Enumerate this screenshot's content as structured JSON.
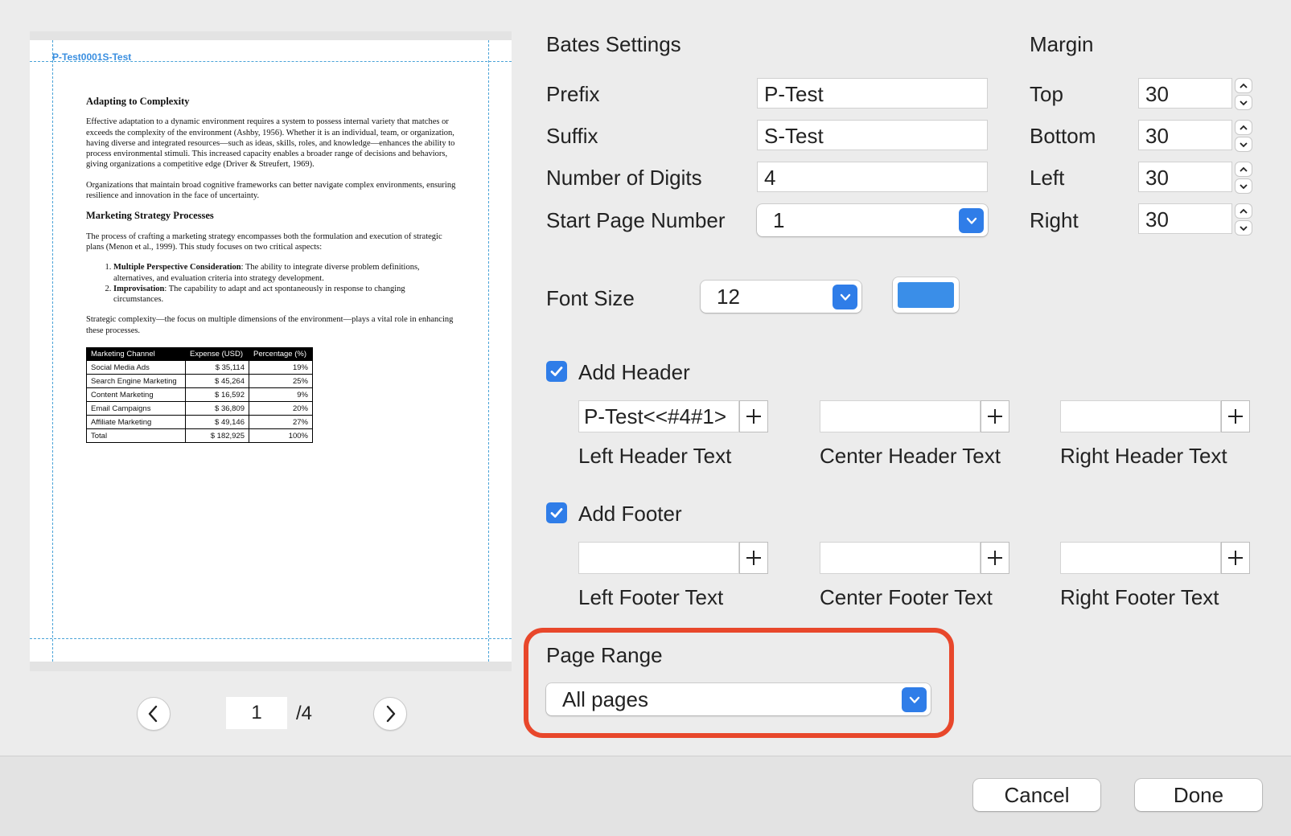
{
  "preview": {
    "bates_stamp": "P-Test0001S-Test",
    "doc": {
      "h1": "Adapting to Complexity",
      "p1": "Effective adaptation to a dynamic environment requires a system to possess internal variety that matches or exceeds the complexity of the environment (Ashby, 1956). Whether it is an individual, team, or organization, having diverse and integrated resources—such as ideas, skills, roles, and knowledge—enhances the ability to process environmental stimuli. This increased capacity enables a broader range of decisions and behaviors, giving organizations a competitive edge (Driver & Streufert, 1969).",
      "p2": "Organizations that maintain broad cognitive frameworks can better navigate complex environments, ensuring resilience and innovation in the face of uncertainty.",
      "h2": "Marketing Strategy Processes",
      "p3": "The process of crafting a marketing strategy encompasses both the formulation and execution of strategic plans (Menon et al., 1999). This study focuses on two critical aspects:",
      "li1_bold": "Multiple Perspective Consideration",
      "li1_text": ": The ability to integrate diverse problem definitions, alternatives, and evaluation criteria into strategy development.",
      "li2_bold": "Improvisation",
      "li2_text": ": The capability to adapt and act spontaneously in response to changing circumstances.",
      "p4": "Strategic complexity—the focus on multiple dimensions of the environment—plays a vital role in enhancing these processes.",
      "table": {
        "headers": [
          "Marketing Channel",
          "Expense (USD)",
          "Percentage (%)"
        ],
        "rows": [
          [
            "Social Media Ads",
            "$ 35,114",
            "19%"
          ],
          [
            "Search Engine Marketing",
            "$ 45,264",
            "25%"
          ],
          [
            "Content Marketing",
            "$ 16,592",
            "9%"
          ],
          [
            "Email Campaigns",
            "$ 36,809",
            "20%"
          ],
          [
            "Affiliate Marketing",
            "$ 49,146",
            "27%"
          ],
          [
            "Total",
            "$ 182,925",
            "100%"
          ]
        ]
      }
    },
    "current_page": "1",
    "total_pages": "/4"
  },
  "bates": {
    "title": "Bates Settings",
    "prefix_label": "Prefix",
    "prefix_value": "P-Test",
    "suffix_label": "Suffix",
    "suffix_value": "S-Test",
    "digits_label": "Number of Digits",
    "digits_value": "4",
    "start_label": "Start Page Number",
    "start_value": "1"
  },
  "margin": {
    "title": "Margin",
    "top_label": "Top",
    "top_value": "30",
    "bottom_label": "Bottom",
    "bottom_value": "30",
    "left_label": "Left",
    "left_value": "30",
    "right_label": "Right",
    "right_value": "30"
  },
  "font": {
    "label": "Font Size",
    "value": "12",
    "color": "#3a8ee8"
  },
  "header": {
    "label": "Add Header",
    "checked": true,
    "left_value": "P-Test<<#4#1>",
    "left_label": "Left Header Text",
    "center_label": "Center Header Text",
    "right_label": "Right Header Text"
  },
  "footer": {
    "label": "Add Footer",
    "checked": true,
    "left_label": "Left Footer Text",
    "center_label": "Center Footer Text",
    "right_label": "Right Footer Text"
  },
  "range": {
    "label": "Page Range",
    "value": "All pages"
  },
  "buttons": {
    "cancel": "Cancel",
    "done": "Done"
  },
  "colors": {
    "accent": "#2f7de8",
    "highlight": "#e8472b"
  }
}
